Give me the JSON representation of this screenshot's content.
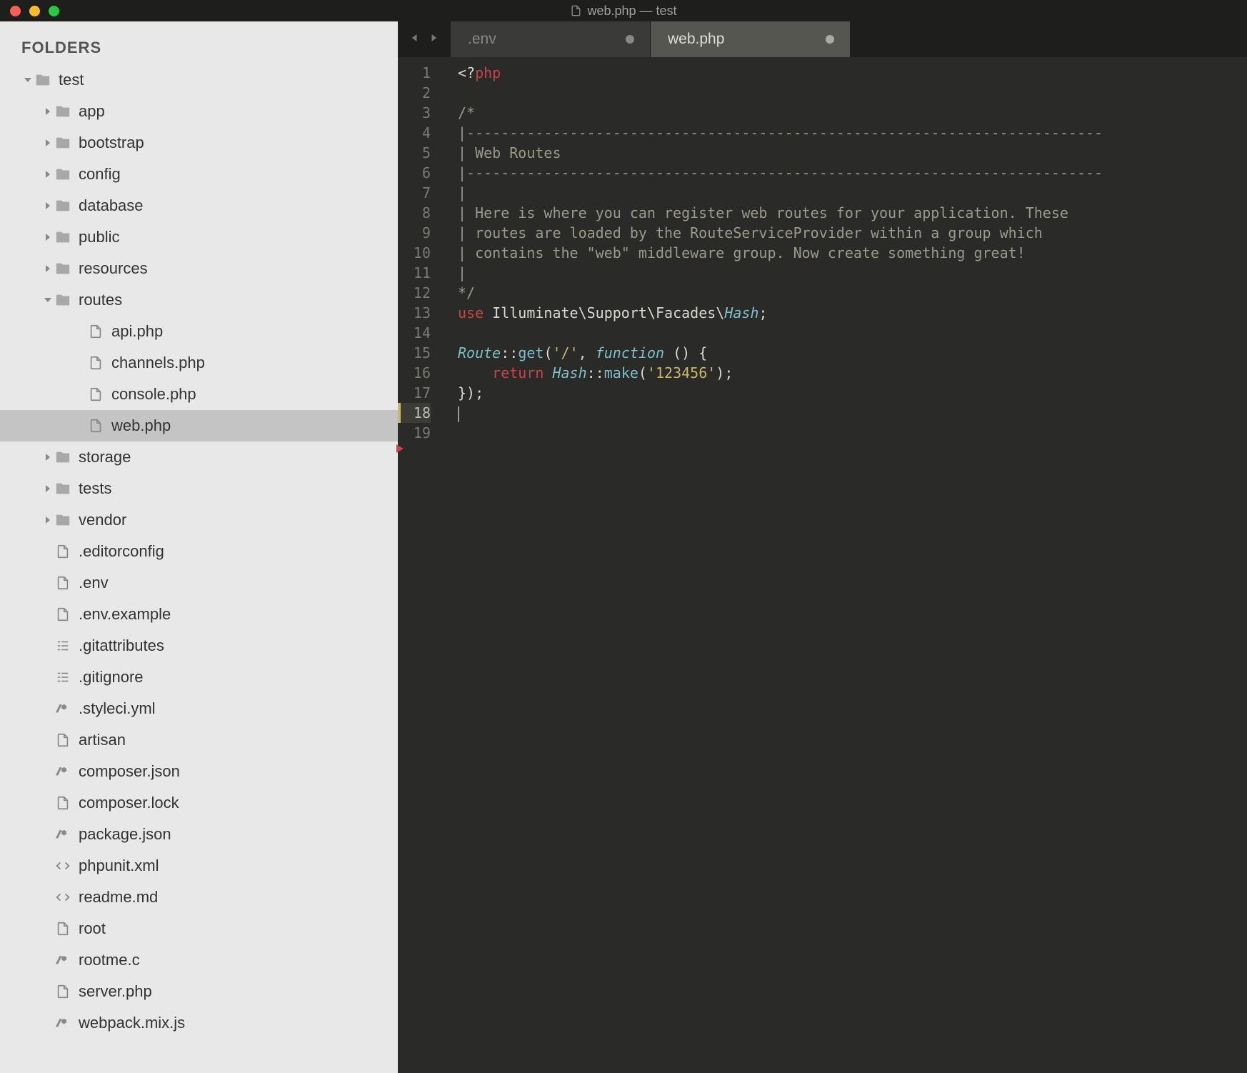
{
  "window": {
    "title": "web.php — test"
  },
  "sidebar": {
    "header": "FOLDERS",
    "tree": [
      {
        "id": "test",
        "label": "test",
        "type": "folder",
        "indent": 0,
        "expanded": true
      },
      {
        "id": "app",
        "label": "app",
        "type": "folder",
        "indent": 1,
        "expanded": false
      },
      {
        "id": "bootstrap",
        "label": "bootstrap",
        "type": "folder",
        "indent": 1,
        "expanded": false
      },
      {
        "id": "config",
        "label": "config",
        "type": "folder",
        "indent": 1,
        "expanded": false
      },
      {
        "id": "database",
        "label": "database",
        "type": "folder",
        "indent": 1,
        "expanded": false
      },
      {
        "id": "public",
        "label": "public",
        "type": "folder",
        "indent": 1,
        "expanded": false
      },
      {
        "id": "resources",
        "label": "resources",
        "type": "folder",
        "indent": 1,
        "expanded": false
      },
      {
        "id": "routes",
        "label": "routes",
        "type": "folder",
        "indent": 1,
        "expanded": true
      },
      {
        "id": "api.php",
        "label": "api.php",
        "type": "file-php",
        "indent": 2
      },
      {
        "id": "channels.php",
        "label": "channels.php",
        "type": "file-php",
        "indent": 2
      },
      {
        "id": "console.php",
        "label": "console.php",
        "type": "file-php",
        "indent": 2
      },
      {
        "id": "web.php",
        "label": "web.php",
        "type": "file-php",
        "indent": 2,
        "selected": true
      },
      {
        "id": "storage",
        "label": "storage",
        "type": "folder",
        "indent": 1,
        "expanded": false
      },
      {
        "id": "tests",
        "label": "tests",
        "type": "folder",
        "indent": 1,
        "expanded": false
      },
      {
        "id": "vendor",
        "label": "vendor",
        "type": "folder",
        "indent": 1,
        "expanded": false
      },
      {
        "id": ".editorconfig",
        "label": ".editorconfig",
        "type": "file-doc",
        "indent": 1
      },
      {
        "id": ".env",
        "label": ".env",
        "type": "file-doc",
        "indent": 1
      },
      {
        "id": ".env.example",
        "label": ".env.example",
        "type": "file-doc",
        "indent": 1
      },
      {
        "id": ".gitattributes",
        "label": ".gitattributes",
        "type": "file-list",
        "indent": 1
      },
      {
        "id": ".gitignore",
        "label": ".gitignore",
        "type": "file-list",
        "indent": 1
      },
      {
        "id": ".styleci.yml",
        "label": ".styleci.yml",
        "type": "file-code",
        "indent": 1
      },
      {
        "id": "artisan",
        "label": "artisan",
        "type": "file-doc",
        "indent": 1
      },
      {
        "id": "composer.json",
        "label": "composer.json",
        "type": "file-code",
        "indent": 1
      },
      {
        "id": "composer.lock",
        "label": "composer.lock",
        "type": "file-doc",
        "indent": 1
      },
      {
        "id": "package.json",
        "label": "package.json",
        "type": "file-code",
        "indent": 1
      },
      {
        "id": "phpunit.xml",
        "label": "phpunit.xml",
        "type": "file-xml",
        "indent": 1
      },
      {
        "id": "readme.md",
        "label": "readme.md",
        "type": "file-xml",
        "indent": 1
      },
      {
        "id": "root",
        "label": "root",
        "type": "file-doc",
        "indent": 1
      },
      {
        "id": "rootme.c",
        "label": "rootme.c",
        "type": "file-code",
        "indent": 1
      },
      {
        "id": "server.php",
        "label": "server.php",
        "type": "file-doc",
        "indent": 1
      },
      {
        "id": "webpack.mix.js",
        "label": "webpack.mix.js",
        "type": "file-code",
        "indent": 1
      }
    ]
  },
  "tabs": [
    {
      "label": ".env",
      "active": false,
      "modified": true
    },
    {
      "label": "web.php",
      "active": true,
      "modified": true
    }
  ],
  "editor": {
    "currentLine": 18,
    "lines": [
      {
        "n": 1,
        "tokens": [
          {
            "t": "<?",
            "c": "c-tag"
          },
          {
            "t": "php",
            "c": "c-keyword"
          }
        ]
      },
      {
        "n": 2,
        "tokens": []
      },
      {
        "n": 3,
        "tokens": [
          {
            "t": "/*",
            "c": "c-comment"
          }
        ]
      },
      {
        "n": 4,
        "tokens": [
          {
            "t": "|--------------------------------------------------------------------------",
            "c": "c-comment"
          }
        ]
      },
      {
        "n": 5,
        "tokens": [
          {
            "t": "| Web Routes",
            "c": "c-comment"
          }
        ]
      },
      {
        "n": 6,
        "tokens": [
          {
            "t": "|--------------------------------------------------------------------------",
            "c": "c-comment"
          }
        ]
      },
      {
        "n": 7,
        "tokens": [
          {
            "t": "|",
            "c": "c-comment"
          }
        ]
      },
      {
        "n": 8,
        "tokens": [
          {
            "t": "| Here is where you can register web routes for your application. These",
            "c": "c-comment"
          }
        ]
      },
      {
        "n": 9,
        "tokens": [
          {
            "t": "| routes are loaded by the RouteServiceProvider within a group which",
            "c": "c-comment"
          }
        ]
      },
      {
        "n": 10,
        "tokens": [
          {
            "t": "| contains the \"web\" middleware group. Now create something great!",
            "c": "c-comment"
          }
        ]
      },
      {
        "n": 11,
        "tokens": [
          {
            "t": "|",
            "c": "c-comment"
          }
        ]
      },
      {
        "n": 12,
        "tokens": [
          {
            "t": "*/",
            "c": "c-comment"
          }
        ]
      },
      {
        "n": 13,
        "tokens": [
          {
            "t": "use",
            "c": "c-keyword"
          },
          {
            "t": " ",
            "c": ""
          },
          {
            "t": "Illuminate",
            "c": "c-ns"
          },
          {
            "t": "\\",
            "c": "c-ns"
          },
          {
            "t": "Support",
            "c": "c-ns"
          },
          {
            "t": "\\",
            "c": "c-ns"
          },
          {
            "t": "Facades",
            "c": "c-ns"
          },
          {
            "t": "\\",
            "c": "c-ns"
          },
          {
            "t": "Hash",
            "c": "c-type c-italic"
          },
          {
            "t": ";",
            "c": ""
          }
        ]
      },
      {
        "n": 14,
        "tokens": []
      },
      {
        "n": 15,
        "tokens": [
          {
            "t": "Route",
            "c": "c-type c-italic"
          },
          {
            "t": "::",
            "c": ""
          },
          {
            "t": "get",
            "c": "c-func"
          },
          {
            "t": "(",
            "c": "c-paren"
          },
          {
            "t": "'/'",
            "c": "c-string"
          },
          {
            "t": ", ",
            "c": ""
          },
          {
            "t": "function",
            "c": "c-type c-italic"
          },
          {
            "t": " () {",
            "c": ""
          }
        ]
      },
      {
        "n": 16,
        "tokens": [
          {
            "t": "    ",
            "c": ""
          },
          {
            "t": "return",
            "c": "c-return"
          },
          {
            "t": " ",
            "c": ""
          },
          {
            "t": "Hash",
            "c": "c-type c-italic"
          },
          {
            "t": "::",
            "c": ""
          },
          {
            "t": "make",
            "c": "c-func"
          },
          {
            "t": "(",
            "c": ""
          },
          {
            "t": "'123456'",
            "c": "c-string"
          },
          {
            "t": ");",
            "c": ""
          }
        ]
      },
      {
        "n": 17,
        "tokens": [
          {
            "t": "});",
            "c": ""
          }
        ]
      },
      {
        "n": 18,
        "tokens": [],
        "cursor": true
      },
      {
        "n": 19,
        "tokens": []
      }
    ]
  }
}
